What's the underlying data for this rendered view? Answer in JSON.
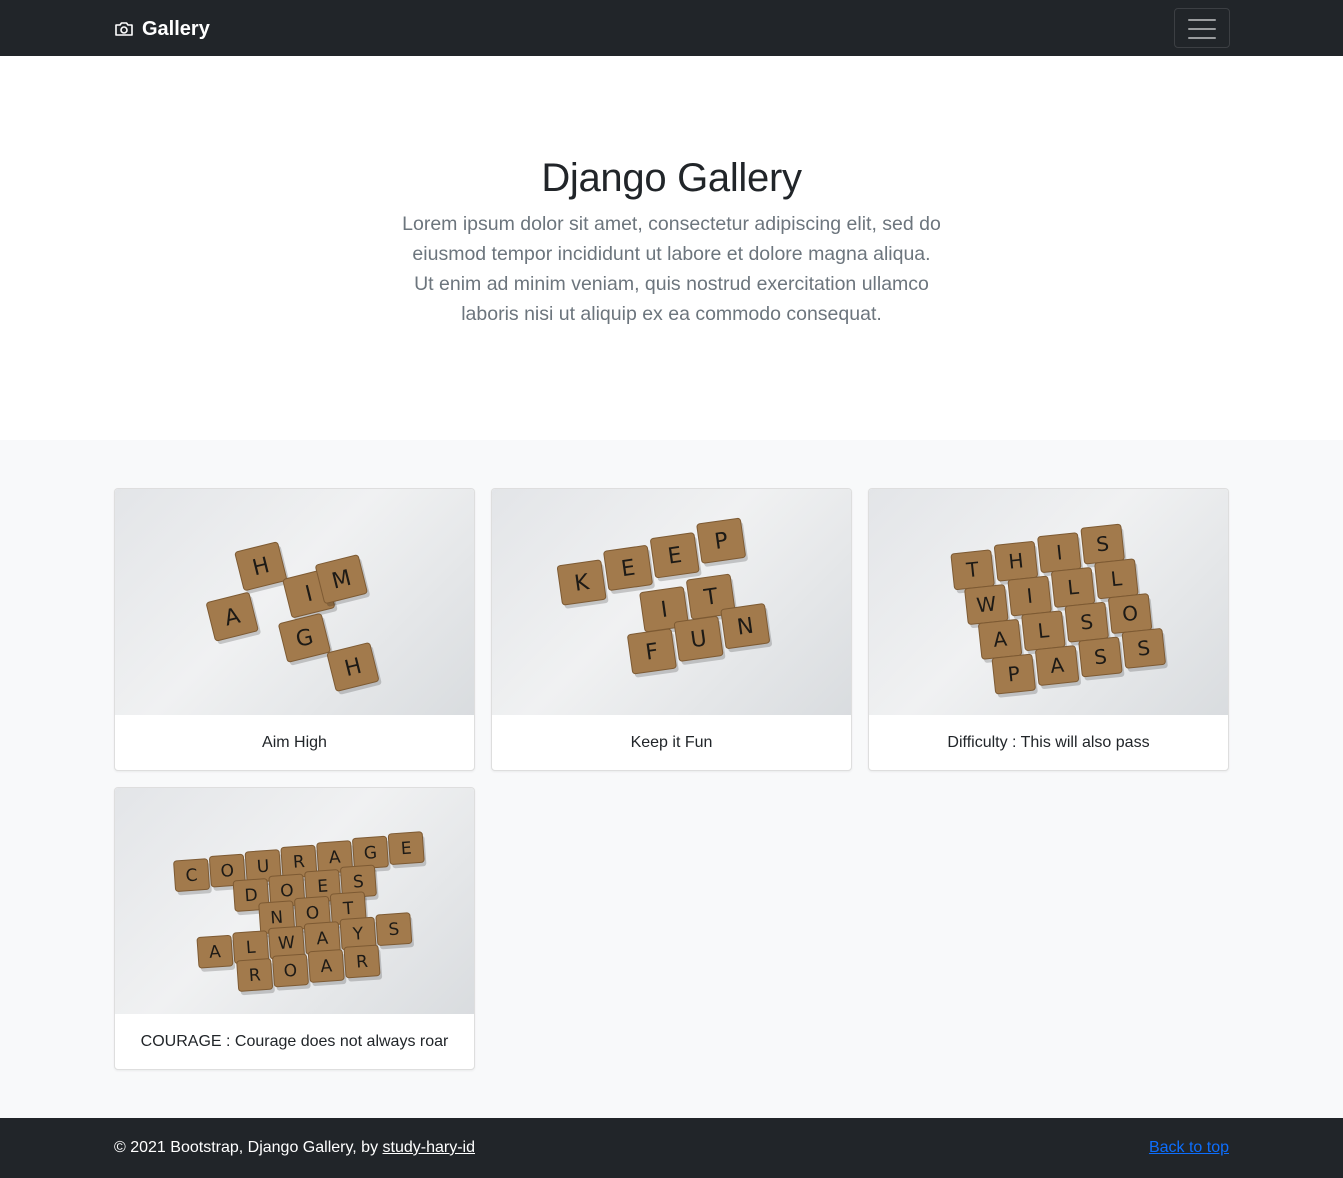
{
  "navbar": {
    "brand_label": "Gallery",
    "brand_icon": "camera-icon",
    "toggler_icon": "menu-icon"
  },
  "hero": {
    "title": "Django Gallery",
    "lead": "Lorem ipsum dolor sit amet, consectetur adipiscing elit, sed do eiusmod tempor incididunt ut labore et dolore magna aliqua. Ut enim ad minim veniam, quis nostrud exercitation ullamco laboris nisi ut aliquip ex ea commodo consequat."
  },
  "gallery": {
    "items": [
      {
        "caption": "Aim High",
        "tiles": [
          "H",
          "A",
          "I",
          "M",
          "G",
          "H"
        ]
      },
      {
        "caption": "Keep it Fun",
        "tiles": [
          "K",
          "E",
          "E",
          "P",
          "I",
          "T",
          "F",
          "U",
          "N"
        ]
      },
      {
        "caption": "Difficulty : This will also pass",
        "tiles": [
          "T",
          "H",
          "I",
          "S",
          "W",
          "I",
          "L",
          "L",
          "A",
          "L",
          "S",
          "O",
          "P",
          "A",
          "S",
          "S"
        ]
      },
      {
        "caption": "COURAGE : Courage does not always roar",
        "tiles": [
          "C",
          "O",
          "U",
          "R",
          "A",
          "G",
          "E",
          "D",
          "O",
          "E",
          "S",
          "N",
          "O",
          "T",
          "A",
          "L",
          "W",
          "A",
          "Y",
          "S",
          "R",
          "O",
          "A",
          "R"
        ]
      }
    ]
  },
  "footer": {
    "copyright_prefix": "© 2021 Bootstrap, Django Gallery, by ",
    "author_link": "study-hary-id",
    "back_to_top": "Back to top"
  },
  "colors": {
    "navbar_bg": "#212529",
    "album_bg": "#f8f9fa",
    "link": "#0d6efd",
    "tile": "#a27a4c"
  }
}
